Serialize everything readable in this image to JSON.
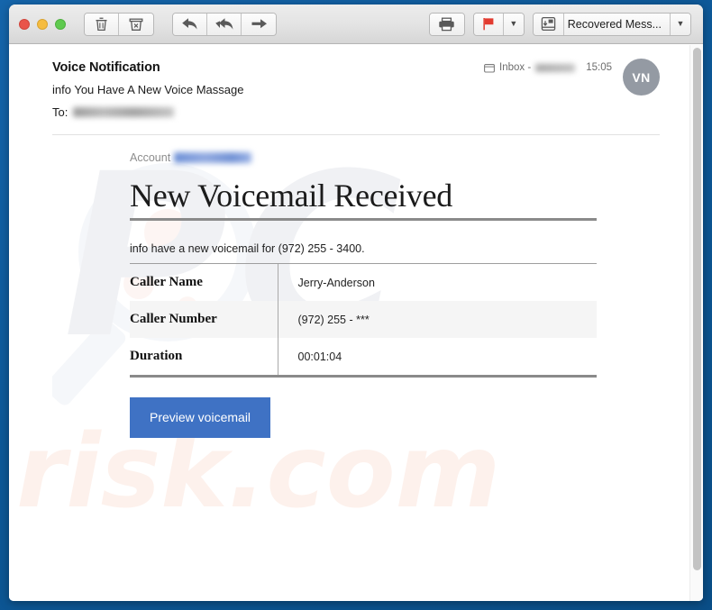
{
  "window": {
    "traffic_lights": [
      "close",
      "minimize",
      "maximize"
    ]
  },
  "toolbar": {
    "delete_label": "Delete",
    "junk_label": "Junk",
    "reply_label": "Reply",
    "reply_all_label": "Reply All",
    "forward_label": "Forward",
    "print_label": "Print",
    "flag_label": "Flag",
    "flag_color": "#e23b30",
    "flag_menu_label": "Flag options",
    "move_label": "Move to",
    "mailbox_selector": "Recovered Mess...",
    "mailbox_menu_label": "Mailbox options"
  },
  "message": {
    "subject": "Voice Notification",
    "sender": "info You Have A New Voice Massage",
    "to_label": "To:",
    "to_value_redacted": true,
    "mailbox_prefix": "Inbox -",
    "mailbox_value_redacted": true,
    "time": "15:05",
    "avatar_initials": "VN"
  },
  "email_body": {
    "account_label": "Account",
    "account_value_redacted": true,
    "headline": "New Voicemail Received",
    "intro": "info have a new voicemail for (972) 255 - 3400.",
    "table": {
      "rows": [
        {
          "label": "Caller Name",
          "value": "Jerry-Anderson"
        },
        {
          "label": "Caller Number",
          "value": "(972) 255 - ***"
        },
        {
          "label": "Duration",
          "value": "00:01:04"
        }
      ]
    },
    "cta_label": "Preview voicemail",
    "cta_color": "#3f72c4",
    "watermark_text": "risk.com"
  }
}
